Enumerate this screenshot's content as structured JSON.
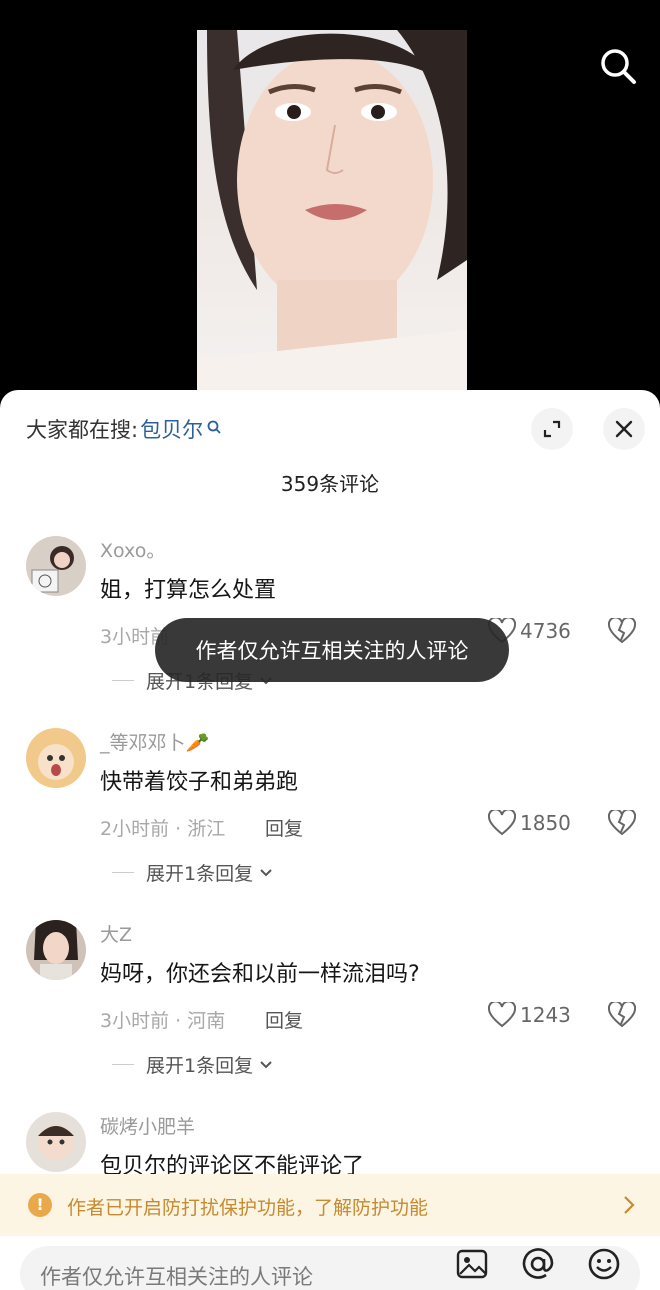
{
  "search_top_icon": "search-icon",
  "hot_search": {
    "prefix": "大家都在搜:",
    "keyword": "包贝尔",
    "keyword_icon": "search-small-icon"
  },
  "header_buttons": {
    "expand_icon": "expand-icon",
    "close_icon": "close-icon"
  },
  "comment_count": "359条评论",
  "comments": [
    {
      "username": "Xoxo。",
      "content": "姐，打算怎么处置",
      "meta": "3小时前",
      "reply": "回复",
      "likes": "4736",
      "expand": "展开1条回复"
    },
    {
      "username": "_等邓邓卜🥕",
      "content": "快带着饺子和弟弟跑",
      "meta": "2小时前 · 浙江",
      "reply": "回复",
      "likes": "1850",
      "expand": "展开1条回复"
    },
    {
      "username": "大Z",
      "content": "妈呀，你还会和以前一样流泪吗?",
      "meta": "3小时前 · 河南",
      "reply": "回复",
      "likes": "1243",
      "expand": "展开1条回复"
    },
    {
      "username": "碳烤小肥羊",
      "content": "包贝尔的评论区不能评论了"
    }
  ],
  "toast": "作者仅允许互相关注的人评论",
  "notice": {
    "text": "作者已开启防打扰保护功能，了解防护功能",
    "color": "#c68a30",
    "icon": "warning-icon"
  },
  "input": {
    "placeholder": "作者仅允许互相关注的人评论",
    "icons": [
      "image-icon",
      "at-icon",
      "emoji-icon"
    ]
  }
}
